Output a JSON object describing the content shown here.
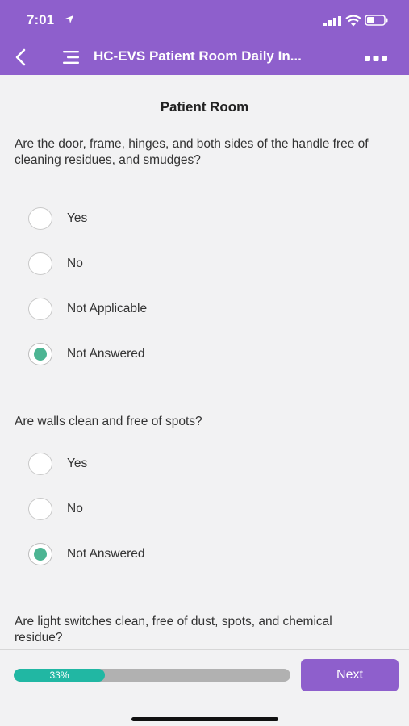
{
  "status_bar": {
    "time": "7:01"
  },
  "header": {
    "title": "HC-EVS Patient Room Daily In..."
  },
  "section_title": "Patient Room",
  "questions": [
    {
      "text": "Are the door, frame, hinges, and both sides of the handle free of cleaning residues, and smudges?",
      "options": [
        {
          "label": "Yes",
          "selected": false
        },
        {
          "label": "No",
          "selected": false
        },
        {
          "label": "Not Applicable",
          "selected": false
        },
        {
          "label": "Not Answered",
          "selected": true
        }
      ]
    },
    {
      "text": "Are walls clean and free of spots?",
      "options": [
        {
          "label": "Yes",
          "selected": false
        },
        {
          "label": "No",
          "selected": false
        },
        {
          "label": "Not Answered",
          "selected": true
        }
      ]
    },
    {
      "text": "Are light switches clean, free of dust, spots, and chemical residue?"
    }
  ],
  "footer": {
    "progress_label": "33%",
    "progress_fraction": 0.33,
    "next_label": "Next"
  },
  "colors": {
    "brand_purple": "#8e5fcc",
    "radio_selected": "#4db593",
    "progress_fill": "#21b7a3"
  },
  "icons": [
    "back-chevron-icon",
    "hamburger-menu-icon",
    "more-dots-icon",
    "location-arrow-icon",
    "cellular-signal-icon",
    "wifi-icon",
    "battery-icon"
  ]
}
